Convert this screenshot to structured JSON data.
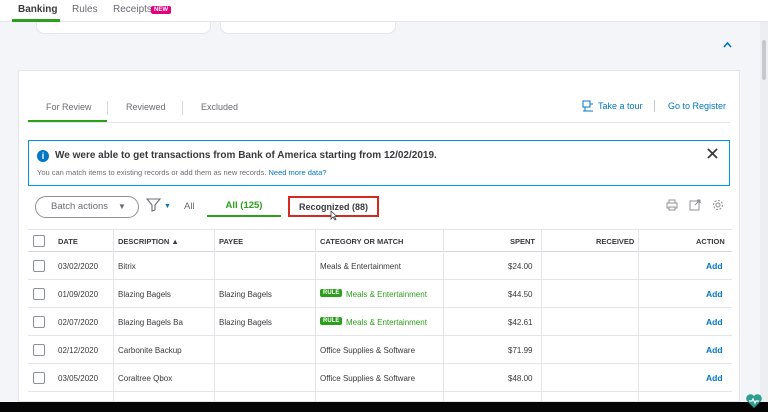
{
  "topnav": {
    "tabs": [
      {
        "label": "Banking"
      },
      {
        "label": "Rules"
      },
      {
        "label": "Receipts"
      }
    ],
    "new_badge": "NEW"
  },
  "subtabs": [
    "For Review",
    "Reviewed",
    "Excluded"
  ],
  "links": {
    "take_tour": "Take a tour",
    "go_register": "Go to Register"
  },
  "banner": {
    "headline": "We were able to get transactions from Bank of America starting from 12/02/2019.",
    "sub_text": "You can match items to existing records or add them as new records.",
    "more_link": "Need more data?"
  },
  "toolbar": {
    "batch_actions": "Batch actions",
    "all_plain": "All",
    "all_pill": "All (125)",
    "recognized_pill": "Recognized (88)"
  },
  "table": {
    "headers": {
      "date": "DATE",
      "description": "DESCRIPTION ▲",
      "payee": "PAYEE",
      "category": "CATEGORY OR MATCH",
      "spent": "SPENT",
      "received": "RECEIVED",
      "action": "ACTION"
    },
    "rows": [
      {
        "date": "03/02/2020",
        "description": "Bitrix",
        "payee": "",
        "rule": "",
        "category": "Meals & Entertainment",
        "spent": "$24.00",
        "received": "",
        "action": "Add"
      },
      {
        "date": "01/09/2020",
        "description": "Blazing Bagels",
        "payee": "Blazing Bagels",
        "rule": "RULE",
        "category": "Meals & Entertainment",
        "spent": "$44.50",
        "received": "",
        "action": "Add"
      },
      {
        "date": "02/07/2020",
        "description": "Blazing Bagels Ba",
        "payee": "Blazing Bagels",
        "rule": "RULE",
        "category": "Meals & Entertainment",
        "spent": "$42.61",
        "received": "",
        "action": "Add"
      },
      {
        "date": "02/12/2020",
        "description": "Carbonite Backup",
        "payee": "",
        "rule": "",
        "category": "Office Supplies & Software",
        "spent": "$71.99",
        "received": "",
        "action": "Add"
      },
      {
        "date": "03/05/2020",
        "description": "Coraltree Qbox",
        "payee": "",
        "rule": "",
        "category": "Office Supplies & Software",
        "spent": "$48.00",
        "received": "",
        "action": "Add"
      }
    ]
  },
  "colors": {
    "green": "#2ca01c",
    "blue": "#0077c5",
    "red_highlight": "#d52b1e"
  }
}
